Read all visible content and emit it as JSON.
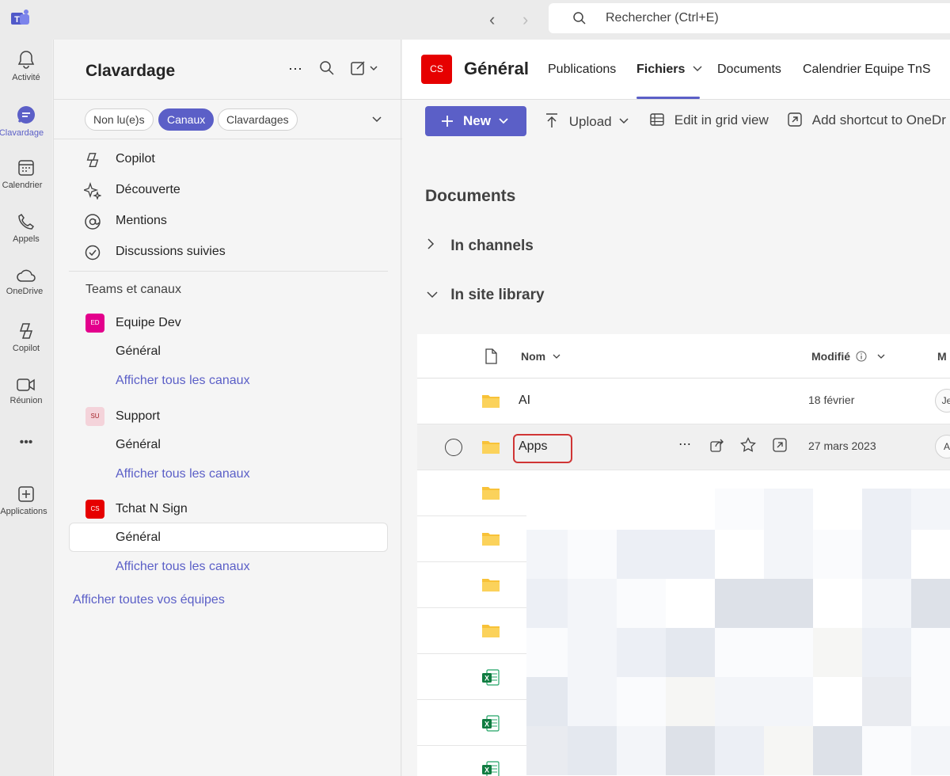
{
  "titlebar": {
    "search_placeholder": "Rechercher (Ctrl+E)"
  },
  "rail": {
    "items": [
      {
        "label": "Activité",
        "icon": "bell-icon"
      },
      {
        "label": "Clavardage",
        "icon": "chat-icon"
      },
      {
        "label": "Calendrier",
        "icon": "calendar-icon"
      },
      {
        "label": "Appels",
        "icon": "phone-icon"
      },
      {
        "label": "OneDrive",
        "icon": "cloud-icon"
      },
      {
        "label": "Copilot",
        "icon": "copilot-icon"
      },
      {
        "label": "Réunion",
        "icon": "video-icon"
      },
      {
        "label": "Applications",
        "icon": "add-app-icon"
      }
    ],
    "more": "•••"
  },
  "panel": {
    "title": "Clavardage",
    "filters": [
      "Non lu(e)s",
      "Canaux",
      "Clavardages"
    ],
    "nav": [
      {
        "label": "Copilot",
        "icon": "copilot-icon"
      },
      {
        "label": "Découverte",
        "icon": "sparkle-icon"
      },
      {
        "label": "Mentions",
        "icon": "at-icon"
      },
      {
        "label": "Discussions suivies",
        "icon": "followed-chat-icon"
      }
    ],
    "section_label": "Teams et canaux",
    "teams": [
      {
        "initials": "ED",
        "name": "Equipe Dev",
        "channel": "Général",
        "link": "Afficher tous les canaux",
        "color": "#e3008c"
      },
      {
        "initials": "SU",
        "name": "Support",
        "channel": "Général",
        "link": "Afficher tous les canaux",
        "color": "#f4c6d0"
      },
      {
        "initials": "CS",
        "name": "Tchat N Sign",
        "channel": "Général",
        "link": "Afficher tous les canaux",
        "color": "#e60000"
      }
    ],
    "all_teams_link": "Afficher toutes vos équipes"
  },
  "main": {
    "channel_initials": "CS",
    "channel_title": "Général",
    "tabs": [
      "Publications",
      "Fichiers",
      "Documents",
      "Calendrier Equipe TnS"
    ],
    "toolbar": {
      "new_label": "New",
      "upload_label": "Upload",
      "grid_label": "Edit in grid view",
      "shortcut_label": "Add shortcut to OneDr"
    },
    "docs_title": "Documents",
    "tree": [
      {
        "label": "In channels",
        "expanded": false
      },
      {
        "label": "In site library",
        "expanded": true
      }
    ],
    "file_headers": {
      "name": "Nom",
      "modified": "Modifié",
      "modified_by": "M"
    },
    "files": [
      {
        "name": "AI",
        "date": "18 février",
        "type": "folder",
        "owner_initial": "Je"
      },
      {
        "name": "Apps",
        "date": "27 mars 2023",
        "type": "folder",
        "owner_initial": "A"
      },
      {
        "name": "",
        "date": "",
        "type": "folder"
      },
      {
        "name": "",
        "date": "",
        "type": "folder"
      },
      {
        "name": "",
        "date": "",
        "type": "folder"
      },
      {
        "name": "",
        "date": "",
        "type": "folder"
      },
      {
        "name": "",
        "date": "",
        "type": "excel"
      },
      {
        "name": "",
        "date": "",
        "type": "excel"
      },
      {
        "name": "",
        "date": "",
        "type": "excel"
      }
    ]
  }
}
